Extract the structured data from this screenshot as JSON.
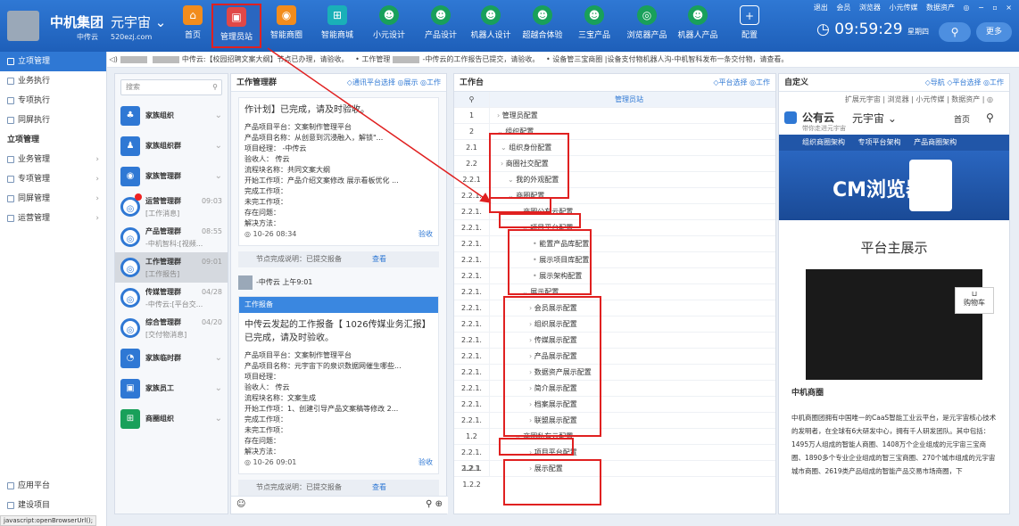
{
  "header": {
    "brand": "中机集团",
    "brand_sub": "中传云",
    "app": "元宇宙",
    "app_sub": "520ezj.com",
    "nav": [
      "首页",
      "管理员站",
      "智能商圈",
      "智能商城",
      "小元设计",
      "产品设计",
      "机器人设计",
      "超越合体验",
      "三宝产品",
      "浏览器产品",
      "机器人产品",
      "配置"
    ],
    "top_links": [
      "退出",
      "会员",
      "浏览器",
      "小元传媒",
      "数据资产"
    ],
    "clock": "09:59:29",
    "weekday": "星期四",
    "more": "更多"
  },
  "leftnav": {
    "items": [
      "立项管理",
      "业务执行",
      "专项执行",
      "同屏执行"
    ],
    "section": "立项管理",
    "sub": [
      "业务管理",
      "专项管理",
      "同屏管理",
      "运营管理"
    ],
    "bottom": [
      "应用平台",
      "建设项目"
    ]
  },
  "ticker": [
    "中传云:【校园招聘文案大纲】节点已办理，请验收。",
    "• 工作管理",
    "-中传云的工作报告已提交，请验收。",
    "• 设备管三宝商圈 |设备支付物机器人沟",
    "-中机智科发布一条交付物，请查看。"
  ],
  "groups": {
    "search": "搜索",
    "items": [
      {
        "name": "家族组织",
        "sub": "",
        "time": ""
      },
      {
        "name": "家族组织群",
        "sub": "",
        "time": ""
      },
      {
        "name": "家族管理群",
        "sub": "",
        "time": ""
      },
      {
        "name": "运营管理群",
        "sub": "[工作消息]",
        "time": "09:03"
      },
      {
        "name": "产品管理群",
        "sub": "-中机智科:[视频...",
        "time": "08:55"
      },
      {
        "name": "工作管理群",
        "sub": "[工作报告]",
        "time": "09:01"
      },
      {
        "name": "传媒管理群",
        "sub": "-中传云:[平台交...",
        "time": "04/28"
      },
      {
        "name": "综合管理群",
        "sub": "[交付物消息]",
        "time": "04/20"
      },
      {
        "name": "家族临时群",
        "sub": "",
        "time": ""
      },
      {
        "name": "家族员工",
        "sub": "",
        "time": ""
      },
      {
        "name": "商圈组织",
        "sub": "",
        "time": ""
      }
    ]
  },
  "chat": {
    "title": "工作管理群",
    "links": "◇通讯平台选择  ◎展示  ◎工作",
    "card1": {
      "head": "作计划】已完成，请及时验收。",
      "lines": [
        "产品项目平台：文案制作管理平台",
        "产品项目名称：从创意到沉浸融入，解锁\"...",
        "项目经理：  -中传云",
        "验收人：  传云",
        "流程块名称：共同文案大纲",
        "开始工作项：产品介绍文案修改 展示看板优化 ...",
        "完成工作项：",
        "未完工作项：",
        "存在问题：",
        "解决方法："
      ],
      "time": "◎ 10-26 08:34",
      "ok": "验收"
    },
    "note": "节点完成说明：已提交报备",
    "view": "查看",
    "sender": "-中传云  上午9:01",
    "card2": {
      "bar": "工作报备",
      "big": "中传云发起的工作报备【  1026传媒业务汇报】已完成，请及时验收。",
      "lines": [
        "产品项目平台：文案制作管理平台",
        "产品项目名称：元宇宙下的泉识数据网催生哪些...",
        "项目经理：",
        "验收人：  传云",
        "流程块名称：文案生成",
        "开始工作项：1、创建引导产品文案稿等修改 2...",
        "完成工作项：",
        "未完工作项：",
        "存在问题：",
        "解决方法："
      ],
      "time": "◎ 10-26 09:01",
      "ok": "验收"
    }
  },
  "tree": {
    "title": "工作台",
    "links": "◇平台选择 ◎工作",
    "header": "管理员站",
    "rows": [
      [
        "1",
        "管理员配置"
      ],
      [
        "2",
        "组织配置"
      ],
      [
        "2.1",
        "组织身份配置"
      ],
      [
        "2.2",
        "商圈社交配置"
      ],
      [
        "2.2.1",
        "我的外观配置"
      ],
      [
        "2.2.1.",
        "商圈配置"
      ],
      [
        "2.2.1.",
        "商圈公有云配置"
      ],
      [
        "2.2.1.",
        "项目平台配置"
      ],
      [
        "2.2.1.",
        "能置产品库配置"
      ],
      [
        "2.2.1.",
        "展示项目库配置"
      ],
      [
        "2.2.1.",
        "展示架构配置"
      ],
      [
        "2.2.1.",
        "展示配置"
      ],
      [
        "2.2.1.",
        "会员展示配置"
      ],
      [
        "2.2.1.",
        "组织展示配置"
      ],
      [
        "2.2.1.",
        "传媒展示配置"
      ],
      [
        "2.2.1.",
        "产品展示配置"
      ],
      [
        "2.2.1.",
        "数据资产展示配置"
      ],
      [
        "2.2.1.",
        "简介展示配置"
      ],
      [
        "2.2.1.",
        "档案展示配置"
      ],
      [
        "2.2.1.",
        "联盟展示配置"
      ],
      [
        "1.2",
        "商圈私有云配置"
      ],
      [
        "2.2.1. 1.2.1",
        "项目平台配置"
      ],
      [
        "2.2.1. 1.2.2",
        "展示配置"
      ]
    ]
  },
  "custom": {
    "title": "自定义",
    "links": "◇导航 ◇平台选择 ◎工作",
    "browser": "扩展元宇宙 | 浏览器 | 小元传媒 | 数据资产 | ◎",
    "brand": "公有云",
    "brand_sub": "带你走进元宇宙",
    "app": "元宇宙",
    "home": "首页",
    "band": [
      "组织商圈架构",
      "专项平台架构",
      "产品商圈架构"
    ],
    "hero": "CM浏览器",
    "show": "平台主展示",
    "cart": "购物车",
    "about_title": "中机商圈",
    "about": "中机商圈团拥有中国唯一的CaaS智能工业云平台，是元宇宙核心技术的发明者，在全球有6大研发中心，拥有千人研发团队。其中包括：1495万人组成的智能人商圈、1408万个企业组成的元宇宙三宝商圈、1890多个专业企业组成的智三宝商圈、270个城市组成的元宇宙城市商圈、2619类产品组成的智能产品交易市场商圈，下"
  },
  "status": "javascript:openBrowserUrl();"
}
